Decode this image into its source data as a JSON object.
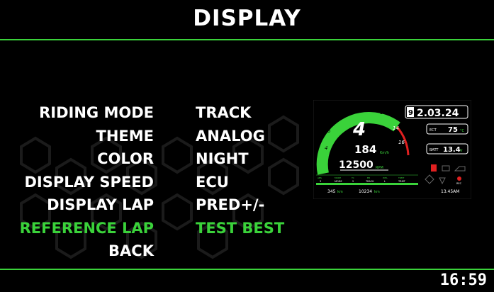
{
  "header": {
    "title": "DISPLAY"
  },
  "menu": {
    "items": [
      {
        "label": "RIDING MODE",
        "value": "TRACK",
        "selected": false
      },
      {
        "label": "THEME",
        "value": "ANALOG",
        "selected": false
      },
      {
        "label": "COLOR",
        "value": "NIGHT",
        "selected": false
      },
      {
        "label": "DISPLAY SPEED",
        "value": "ECU",
        "selected": false
      },
      {
        "label": "DISPLAY LAP",
        "value": "PRED+/-",
        "selected": false
      },
      {
        "label": "REFERENCE LAP",
        "value": "TEST BEST",
        "selected": true
      }
    ],
    "back_label": "BACK"
  },
  "preview": {
    "gear": "4",
    "speed": "184",
    "speed_unit": "Km/h",
    "rpm": "12500",
    "rpm_unit": "RPM",
    "tach_labels": [
      "4",
      "6",
      "8",
      "10",
      "12",
      "14",
      "16"
    ],
    "lap_number": "9",
    "lap_time": "2.03.24",
    "ect_label": "ECT",
    "ect_value": "75",
    "ect_unit": "°C",
    "batt_label": "BATT",
    "batt_value": "13.4",
    "batt_unit": "V",
    "odo": "345",
    "trip": "10234",
    "dist_unit": "km",
    "time": "13.45AM",
    "rec_label": "REC",
    "mode_labels": [
      "ABS",
      "MODE",
      "TC",
      "EB",
      "WHL",
      "TRMT"
    ],
    "mode_values": [
      "3",
      "MODE",
      "2",
      "TRACK",
      "L",
      "TRMT"
    ],
    "colors": {
      "accent": "#3ad23a",
      "redline": "#e02020"
    }
  },
  "footer": {
    "clock": "16:59"
  }
}
